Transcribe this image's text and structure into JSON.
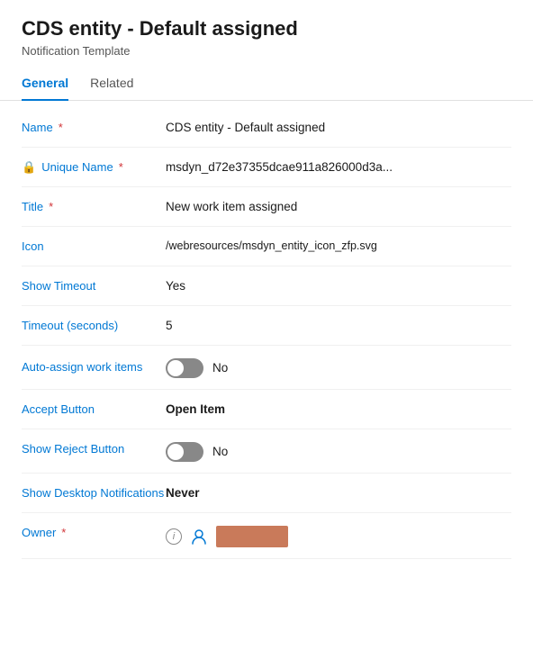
{
  "header": {
    "title": "CDS entity - Default assigned",
    "subtitle": "Notification Template"
  },
  "tabs": [
    {
      "id": "general",
      "label": "General",
      "active": true
    },
    {
      "id": "related",
      "label": "Related",
      "active": false
    }
  ],
  "fields": [
    {
      "id": "name",
      "label": "Name",
      "required": true,
      "value": "CDS entity - Default assigned",
      "bold": false,
      "type": "text"
    },
    {
      "id": "unique_name",
      "label": "Unique Name",
      "required": true,
      "value": "msdyn_d72e37355dcae911a826000d3a...",
      "bold": false,
      "type": "text",
      "truncated": true,
      "locked": true
    },
    {
      "id": "title",
      "label": "Title",
      "required": true,
      "value": "New work item assigned",
      "bold": false,
      "type": "text"
    },
    {
      "id": "icon",
      "label": "Icon",
      "required": false,
      "value": "/webresources/msdyn_entity_icon_zfp.svg",
      "bold": false,
      "type": "text"
    },
    {
      "id": "show_timeout",
      "label": "Show Timeout",
      "required": false,
      "value": "Yes",
      "bold": false,
      "type": "text"
    },
    {
      "id": "timeout_seconds",
      "label": "Timeout (seconds)",
      "required": false,
      "value": "5",
      "bold": false,
      "type": "text"
    },
    {
      "id": "auto_assign",
      "label": "Auto-assign work items",
      "required": false,
      "value": "No",
      "bold": false,
      "type": "toggle",
      "toggled": false
    },
    {
      "id": "accept_button",
      "label": "Accept Button",
      "required": false,
      "value": "Open Item",
      "bold": true,
      "type": "text"
    },
    {
      "id": "show_reject",
      "label": "Show Reject Button",
      "required": false,
      "value": "No",
      "bold": false,
      "type": "toggle",
      "toggled": false
    },
    {
      "id": "show_desktop",
      "label": "Show Desktop Notifications",
      "required": false,
      "value": "Never",
      "bold": true,
      "type": "text"
    },
    {
      "id": "owner",
      "label": "Owner",
      "required": true,
      "value": "",
      "type": "owner"
    }
  ]
}
